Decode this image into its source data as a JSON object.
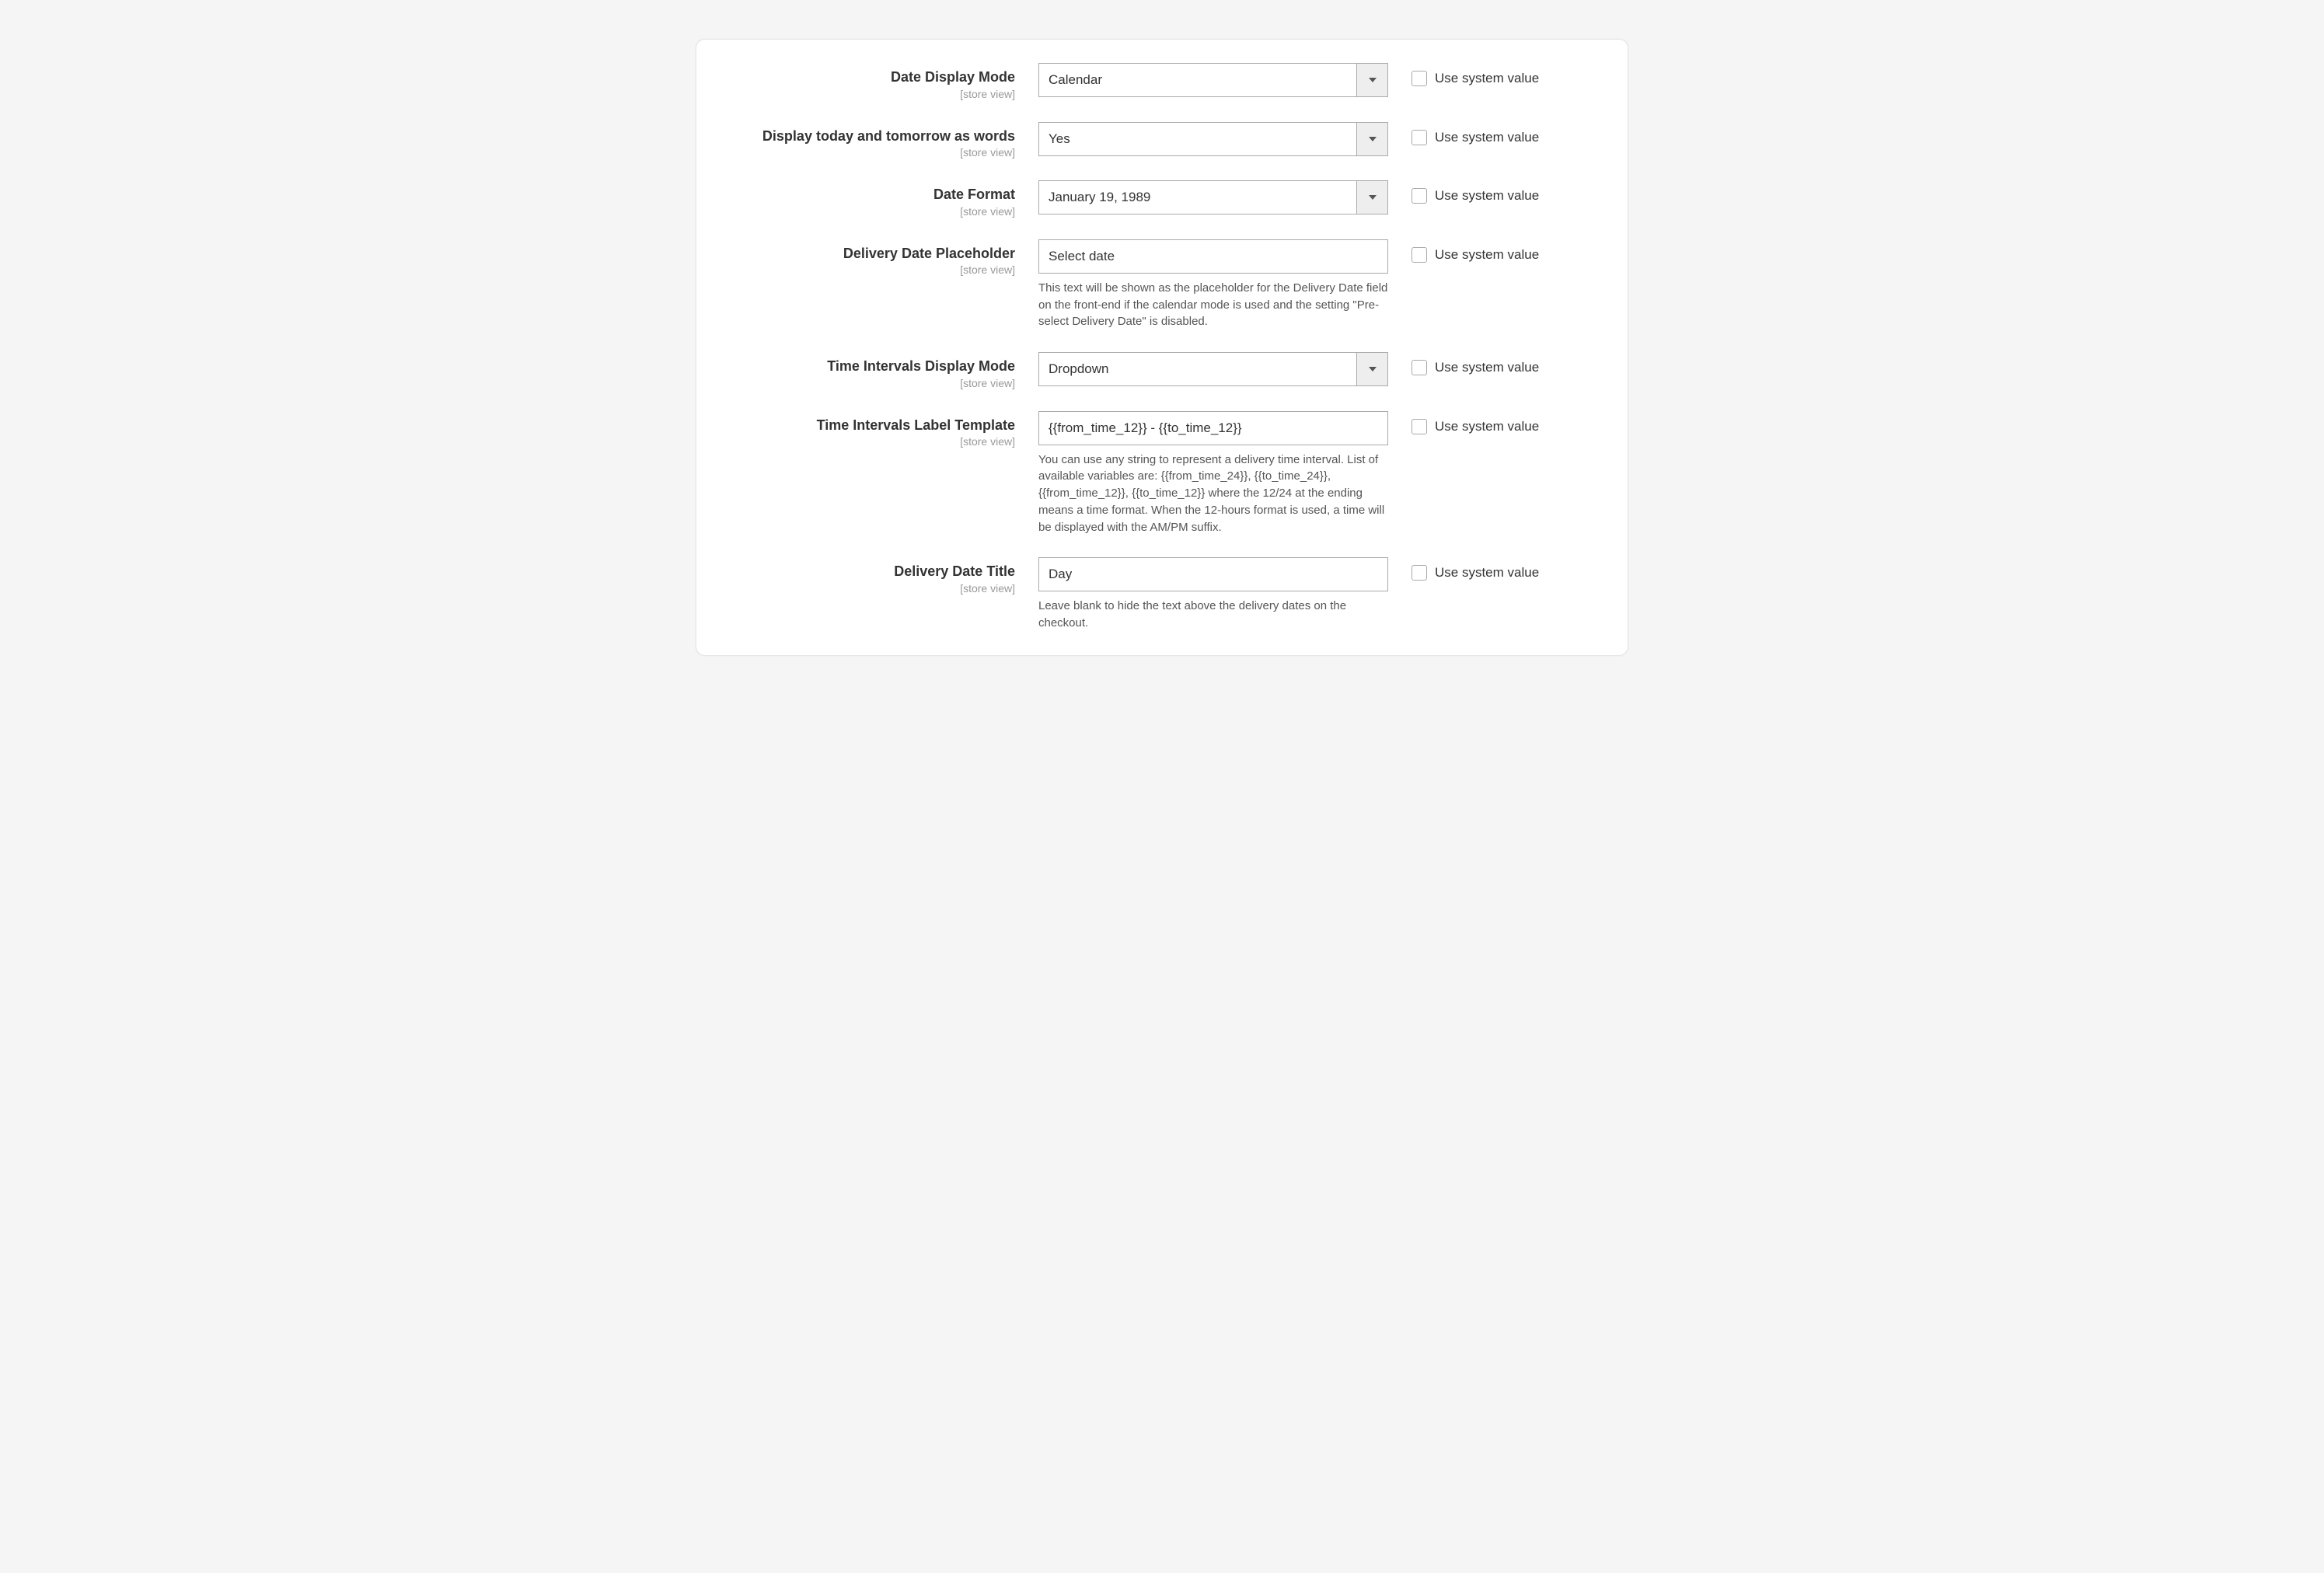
{
  "fields": {
    "date_display_mode": {
      "label": "Date Display Mode",
      "scope": "[store view]",
      "value": "Calendar",
      "use_system_label": "Use system value"
    },
    "words_today_tomorrow": {
      "label": "Display today and tomorrow as words",
      "scope": "[store view]",
      "value": "Yes",
      "use_system_label": "Use system value"
    },
    "date_format": {
      "label": "Date Format",
      "scope": "[store view]",
      "value": "January 19, 1989",
      "use_system_label": "Use system value"
    },
    "placeholder": {
      "label": "Delivery Date Placeholder",
      "scope": "[store view]",
      "value": "Select date",
      "help": "This text will be shown as the placeholder for the Delivery Date field on the front-end if the calendar mode is used and the setting \"Pre-select Delivery Date\" is disabled.",
      "use_system_label": "Use system value"
    },
    "time_intervals_mode": {
      "label": "Time Intervals Display Mode",
      "scope": "[store view]",
      "value": "Dropdown",
      "use_system_label": "Use system value"
    },
    "time_intervals_template": {
      "label": "Time Intervals Label Template",
      "scope": "[store view]",
      "value": "{{from_time_12}} - {{to_time_12}}",
      "help": "You can use any string to represent a delivery time interval. List of available variables are: {{from_time_24}}, {{to_time_24}}, {{from_time_12}}, {{to_time_12}} where the 12/24 at the ending means a time format. When the 12-hours format is used, a time will be displayed with the AM/PM suffix.",
      "use_system_label": "Use system value"
    },
    "delivery_date_title": {
      "label": "Delivery Date Title",
      "scope": "[store view]",
      "value": "Day",
      "help": "Leave blank to hide the text above the delivery dates on the checkout.",
      "use_system_label": "Use system value"
    }
  }
}
